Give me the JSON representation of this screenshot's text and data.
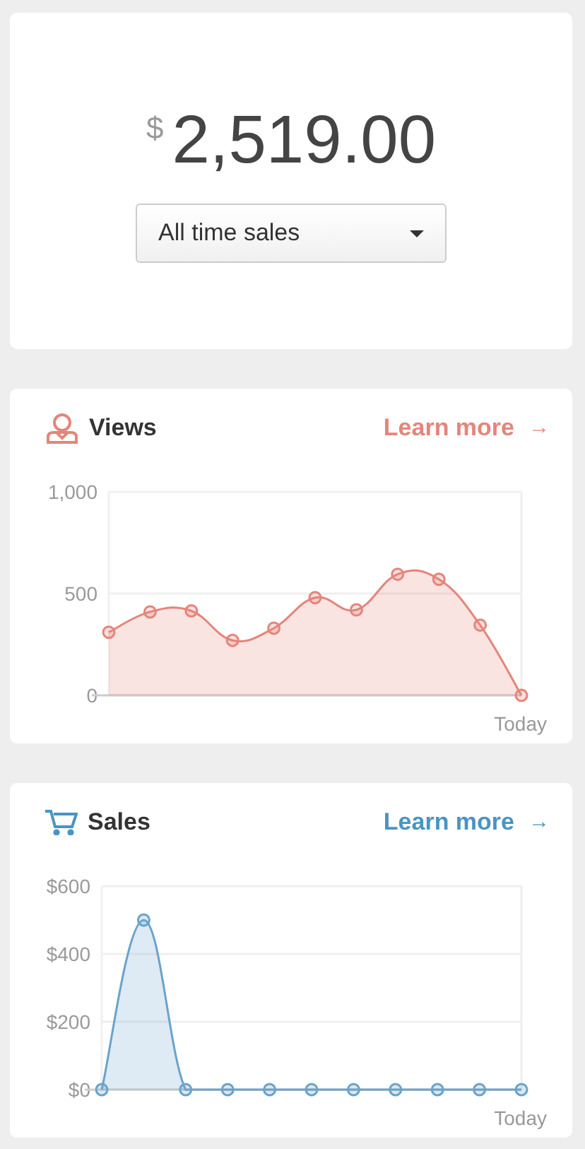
{
  "total": {
    "currency": "$",
    "amount": "2,519.00"
  },
  "period_select": {
    "value": "All time sales"
  },
  "panels": [
    {
      "kind": "views",
      "title": "Views",
      "link": "Learn more",
      "link_arrow": "→",
      "color": "#e5857a",
      "chart_data": {
        "type": "area",
        "xlabel": "Today",
        "ylim": [
          0,
          1000
        ],
        "yticks": [
          {
            "value": 0,
            "label": "0"
          },
          {
            "value": 500,
            "label": "500"
          },
          {
            "value": 1000,
            "label": "1,000"
          }
        ],
        "series": [
          {
            "color": "#e5857a",
            "values": [
              310,
              410,
              415,
              270,
              330,
              480,
              420,
              595,
              570,
              345,
              0
            ]
          }
        ]
      }
    },
    {
      "kind": "sales",
      "title": "Sales",
      "link": "Learn more",
      "link_arrow": "→",
      "color": "#4a94c4",
      "chart_data": {
        "type": "area",
        "xlabel": "Today",
        "ylim": [
          0,
          600
        ],
        "yticks": [
          {
            "value": 0,
            "label": "$0"
          },
          {
            "value": 200,
            "label": "$200"
          },
          {
            "value": 400,
            "label": "$400"
          },
          {
            "value": 600,
            "label": "$600"
          }
        ],
        "series": [
          {
            "color": "#6aa3cb",
            "values": [
              0,
              500,
              0,
              0,
              0,
              0,
              0,
              0,
              0,
              0,
              0
            ]
          }
        ]
      }
    }
  ]
}
